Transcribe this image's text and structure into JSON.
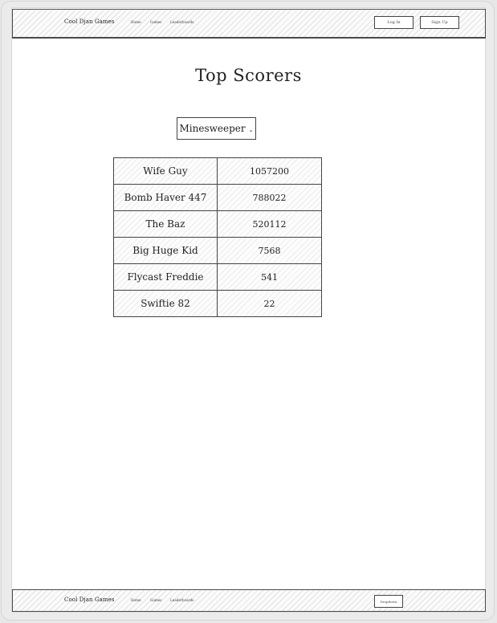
{
  "header": {
    "brand": "Cool Djan Games",
    "nav": [
      "Home",
      "Games",
      "Leaderboards"
    ],
    "login_label": "Log In",
    "signup_label": "Sign Up"
  },
  "main": {
    "title": "Top Scorers",
    "game_select": {
      "selected": "Minesweeper"
    },
    "scores": [
      {
        "name": "Wife Guy",
        "score": "1057200"
      },
      {
        "name": "Bomb Haver 447",
        "score": "788022"
      },
      {
        "name": "The Baz",
        "score": "520112"
      },
      {
        "name": "Big Huge Kid",
        "score": "7568"
      },
      {
        "name": "Flycast Freddie",
        "score": "541"
      },
      {
        "name": "Swiftie 82",
        "score": "22"
      }
    ]
  },
  "footer": {
    "brand": "Cool Djan Games",
    "nav": [
      "Home",
      "Games",
      "Leaderboards"
    ],
    "dropdown_label": "Dropdown"
  },
  "icons": {
    "select_chevron": "chevron-down-icon"
  }
}
